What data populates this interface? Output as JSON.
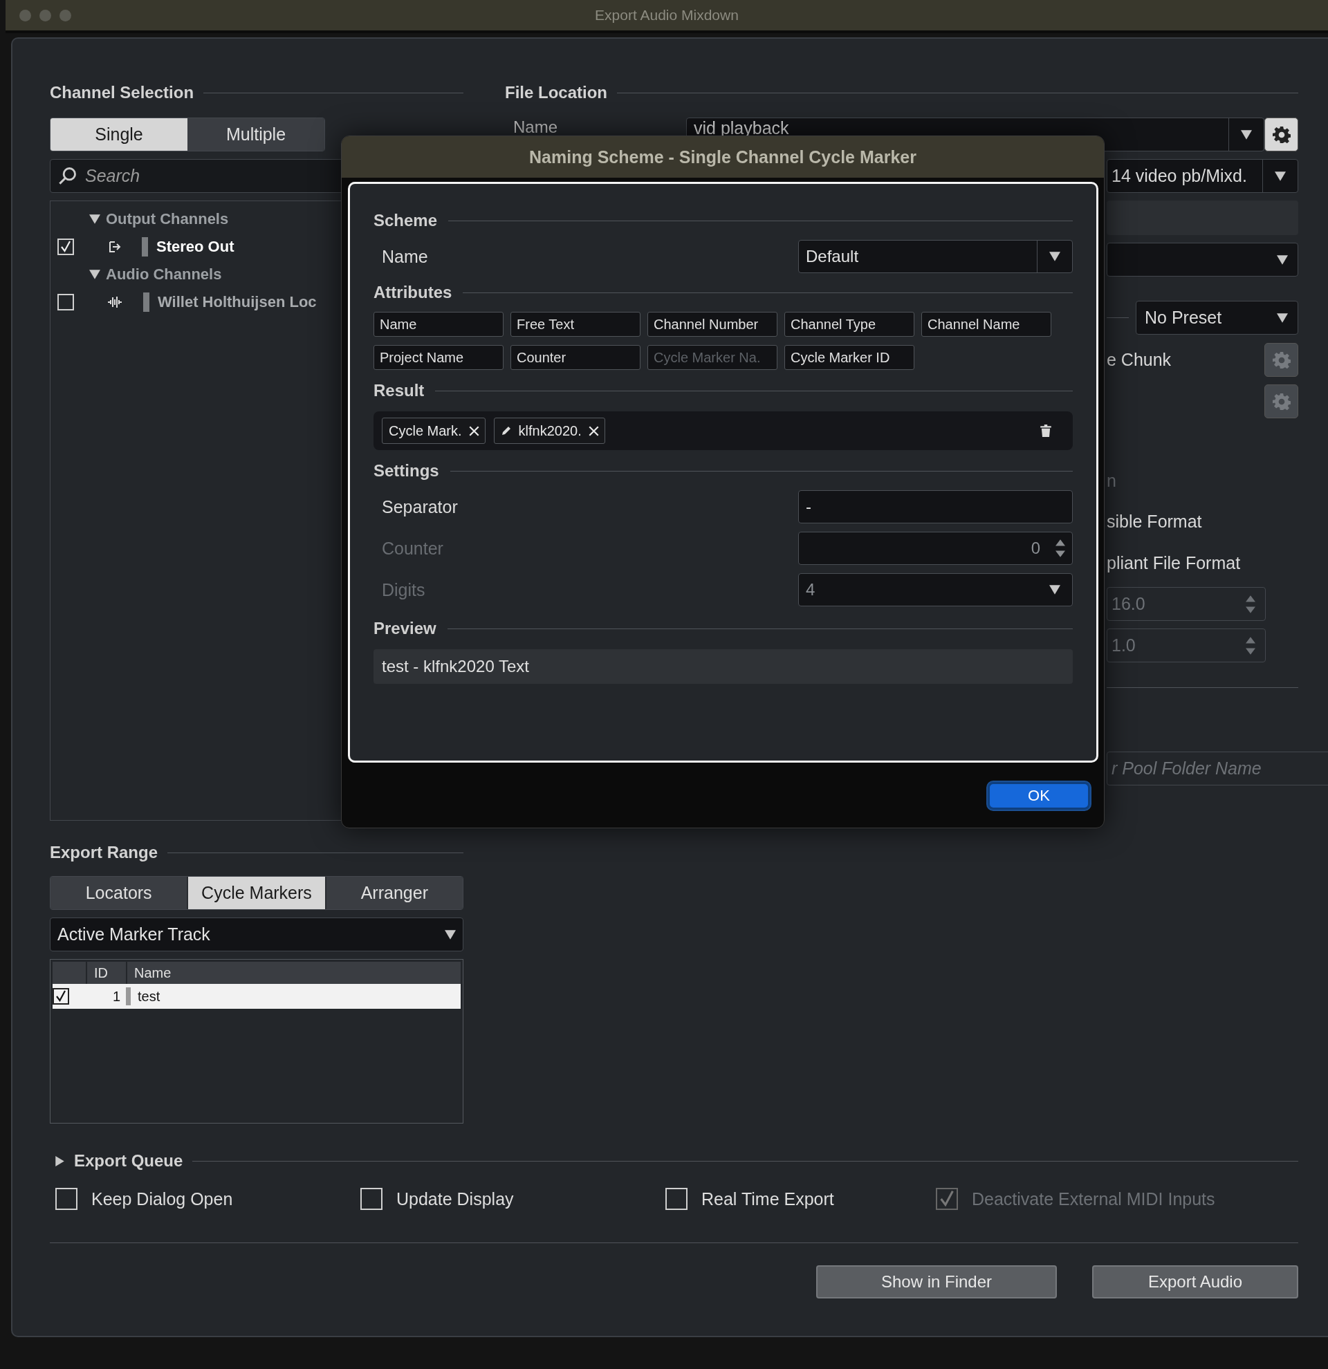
{
  "window": {
    "title": "Export Audio Mixdown"
  },
  "channel_selection": {
    "title": "Channel Selection",
    "modes": [
      {
        "label": "Single",
        "selected": true
      },
      {
        "label": "Multiple",
        "selected": false
      }
    ],
    "search": {
      "placeholder": "Search"
    },
    "tree": [
      {
        "label": "Output Channels",
        "expanded": true,
        "children": [
          {
            "label": "Stereo Out",
            "kind": "output",
            "checked": true
          }
        ]
      },
      {
        "label": "Audio Channels",
        "expanded": true,
        "children": [
          {
            "label": "Willet Holthuijsen Loc",
            "kind": "audio",
            "checked": false
          }
        ]
      }
    ]
  },
  "file_location": {
    "title": "File Location",
    "name_label": "Name",
    "name_value": "vid playback",
    "path": "14 video pb/Mixd.",
    "preset": "No Preset",
    "chunk_label": "e Chunk",
    "faint_label": "n",
    "format_1": "sible Format",
    "format_2": "pliant File Format",
    "spin_1": "16.0",
    "spin_2": "1.0",
    "pool_folder": {
      "placeholder": "r Pool Folder Name"
    }
  },
  "export_range": {
    "title": "Export Range",
    "tabs": [
      {
        "label": "Locators",
        "selected": false
      },
      {
        "label": "Cycle Markers",
        "selected": true
      },
      {
        "label": "Arranger",
        "selected": false
      }
    ],
    "source": "Active Marker Track",
    "table": {
      "columns": [
        "ID",
        "Name"
      ],
      "rows": [
        {
          "checked": true,
          "selected": true,
          "id": "1",
          "name": "test"
        }
      ]
    }
  },
  "export_queue": {
    "title": "Export Queue",
    "expanded": false
  },
  "options": [
    {
      "label": "Keep Dialog Open",
      "checked": false,
      "disabled": false
    },
    {
      "label": "Update Display",
      "checked": false,
      "disabled": false
    },
    {
      "label": "Real Time Export",
      "checked": false,
      "disabled": false
    },
    {
      "label": "Deactivate External MIDI Inputs",
      "checked": true,
      "disabled": true
    }
  ],
  "buttons": [
    "Show in Finder",
    "Export Audio"
  ],
  "naming_dialog": {
    "title": "Naming Scheme - Single Channel Cycle Marker",
    "scheme": {
      "title": "Scheme",
      "name_label": "Name",
      "name_value": "Default"
    },
    "attributes": {
      "title": "Attributes",
      "items": [
        {
          "label": "Name",
          "disabled": false
        },
        {
          "label": "Free Text",
          "disabled": false
        },
        {
          "label": "Channel Number",
          "disabled": false
        },
        {
          "label": "Channel Type",
          "disabled": false
        },
        {
          "label": "Channel Name",
          "disabled": false
        },
        {
          "label": "Project Name",
          "disabled": false
        },
        {
          "label": "Counter",
          "disabled": false
        },
        {
          "label": "Cycle Marker Na.",
          "disabled": true
        },
        {
          "label": "Cycle Marker ID",
          "disabled": false
        }
      ]
    },
    "result": {
      "title": "Result",
      "tokens": [
        {
          "label": "Cycle Mark.",
          "kind": "attribute"
        },
        {
          "label": "klfnk2020.",
          "kind": "text"
        }
      ]
    },
    "settings": {
      "title": "Settings",
      "rows": [
        {
          "label": "Separator",
          "kind": "text",
          "value": "-",
          "disabled": false
        },
        {
          "label": "Counter",
          "kind": "spin",
          "value": "0",
          "disabled": true
        },
        {
          "label": "Digits",
          "kind": "select",
          "value": "4",
          "disabled": true
        }
      ]
    },
    "preview": {
      "title": "Preview",
      "text": "test - klfnk2020 Text"
    },
    "ok": "OK"
  }
}
